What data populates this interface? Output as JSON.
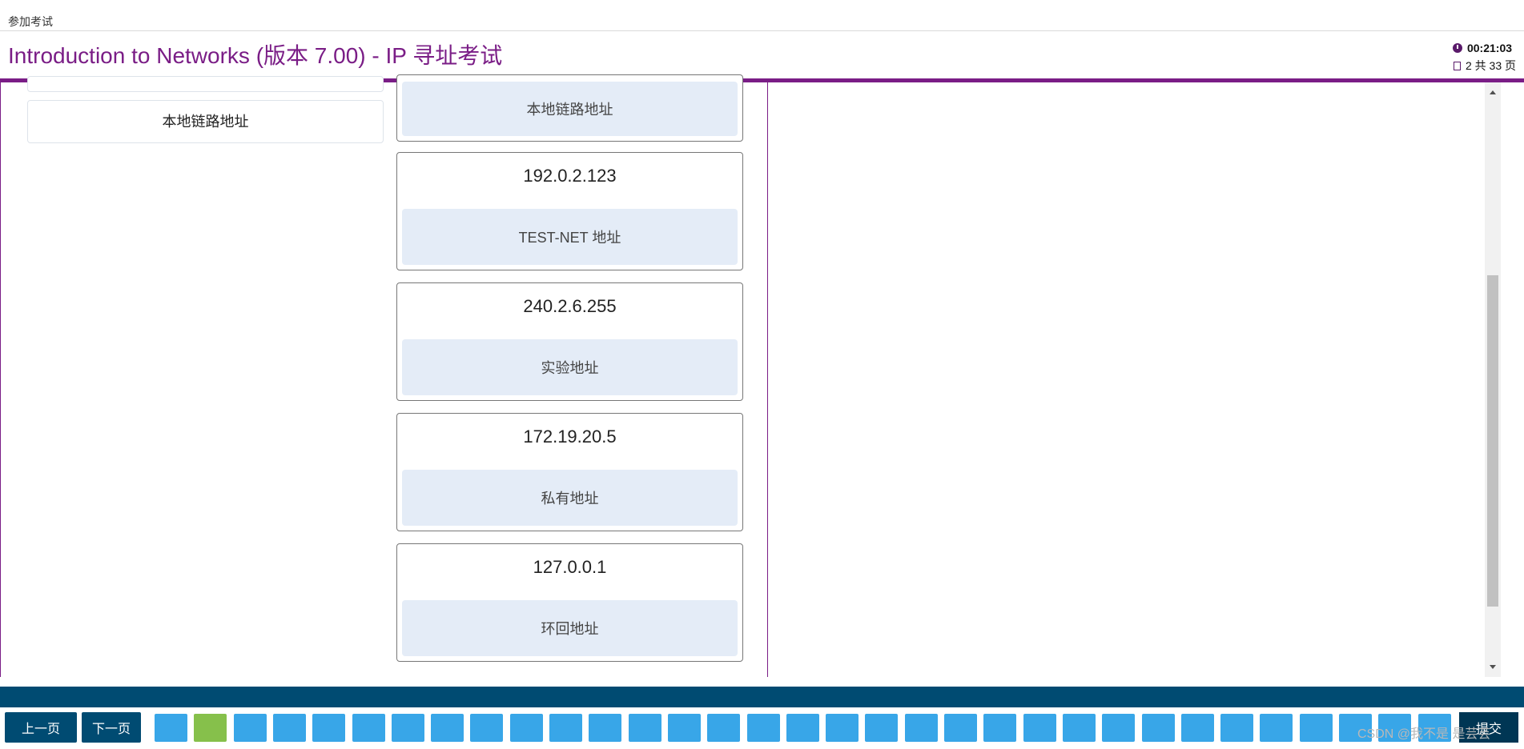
{
  "header": {
    "crumb": "参加考试",
    "title": "Introduction to Networks (版本 7.00) - IP 寻址考试",
    "timer": "00:21:03",
    "page_indicator": "2 共 33 页"
  },
  "left_options": [
    {
      "label": ""
    },
    {
      "label": "本地链路地址"
    }
  ],
  "matches": [
    {
      "ip": "",
      "answer": "本地链路地址"
    },
    {
      "ip": "192.0.2.123",
      "answer": "TEST-NET 地址"
    },
    {
      "ip": "240.2.6.255",
      "answer": "实验地址"
    },
    {
      "ip": "172.19.20.5",
      "answer": "私有地址"
    },
    {
      "ip": "127.0.0.1",
      "answer": "环回地址"
    }
  ],
  "footer": {
    "prev_label": "上一页",
    "next_label": "下一页",
    "submit_label": "提交",
    "question_count": 33,
    "answered": [
      2
    ]
  },
  "watermark": "CSDN @我不是 是芸芸",
  "colors": {
    "accent_purple": "#7a1d86",
    "navy": "#004b72",
    "question_blue": "#38a6e8",
    "question_done": "#86c04b"
  }
}
